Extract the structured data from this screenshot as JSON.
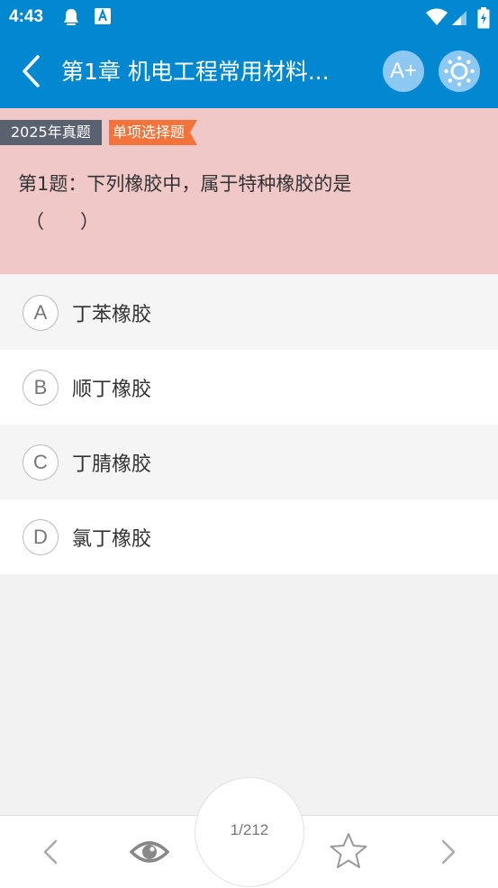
{
  "status": {
    "time": "4:43"
  },
  "header": {
    "title": "第1章 机电工程常用材料...",
    "font_button_label": "A+"
  },
  "question": {
    "year_tag": "2025年真题",
    "type_tag": "单项选择题",
    "text": "第1题：下列橡胶中，属于特种橡胶的是",
    "blank": "（      ）"
  },
  "options": [
    {
      "letter": "A",
      "text": "丁苯橡胶"
    },
    {
      "letter": "B",
      "text": "顺丁橡胶"
    },
    {
      "letter": "C",
      "text": "丁腈橡胶"
    },
    {
      "letter": "D",
      "text": "氯丁橡胶"
    }
  ],
  "footer": {
    "page_indicator": "1/212"
  },
  "colors": {
    "primary": "#0288d1",
    "question_bg": "#f0c8c8",
    "tag_year": "#5a6270",
    "tag_type": "#f2743a"
  }
}
